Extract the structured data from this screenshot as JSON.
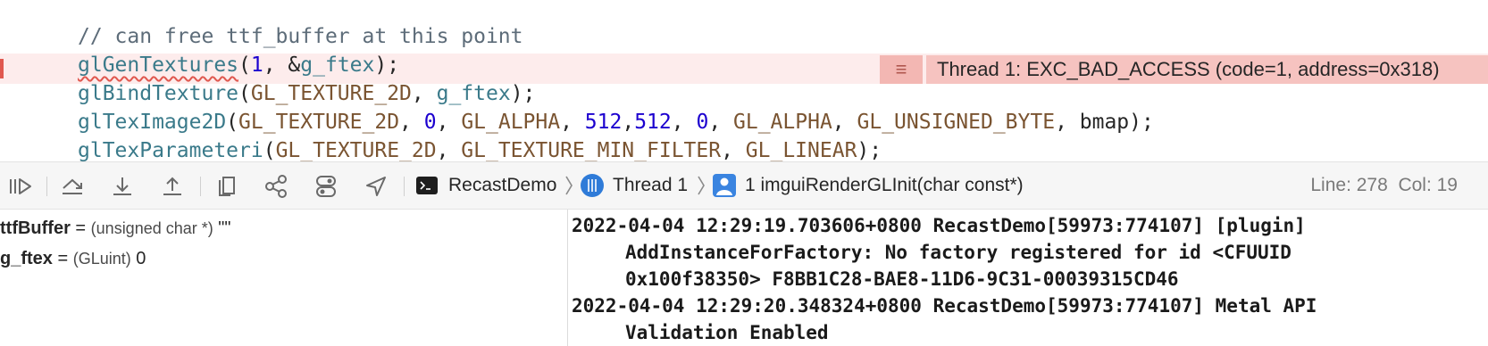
{
  "editor": {
    "comment_line": "// can free ttf_buffer at this point",
    "line_gen": {
      "fn": "glGenTextures",
      "open": "(",
      "num": "1",
      "mid": ", &",
      "arg": "g_ftex",
      "close": ");"
    },
    "line_bind": {
      "fn": "glBindTexture",
      "open": "(",
      "c1": "GL_TEXTURE_2D",
      "mid": ", ",
      "arg": "g_ftex",
      "close": ");"
    },
    "line_image": {
      "fn": "glTexImage2D",
      "open": "(",
      "c1": "GL_TEXTURE_2D",
      "s1": ", ",
      "n1": "0",
      "s2": ", ",
      "c2": "GL_ALPHA",
      "s3": ", ",
      "n2": "512",
      "s4": ",",
      "n3": "512",
      "s5": ", ",
      "n4": "0",
      "s6": ", ",
      "c3": "GL_ALPHA",
      "s7": ", ",
      "c4": "GL_UNSIGNED_BYTE",
      "s8": ", bmap);"
    },
    "line_param": {
      "fn": "glTexParameteri",
      "open": "(",
      "c1": "GL_TEXTURE_2D",
      "s1": ", ",
      "c2": "GL_TEXTURE_MIN_FILTER",
      "s2": ", ",
      "c3": "GL_LINEAR",
      "close": ");"
    },
    "error_annotation": "Thread 1: EXC_BAD_ACCESS (code=1, address=0x318)",
    "error_color": "#f6c3c0"
  },
  "debug_bar": {
    "buttons": [
      "continue-icon",
      "step-over-icon",
      "step-into-icon",
      "step-out-icon",
      "view-hierarchy-icon",
      "memory-graph-icon",
      "environment-overrides-icon",
      "simulate-location-icon"
    ],
    "target": "RecastDemo",
    "thread": "Thread 1",
    "frame": "1 imguiRenderGLInit(char const*)",
    "line": "Line: 278",
    "col": "Col: 19"
  },
  "variables": [
    {
      "name": "ttfBuffer",
      "eq": " = ",
      "type": "(unsigned char *)",
      "value": " \"\""
    },
    {
      "name": "g_ftex",
      "eq": " = ",
      "type": "(GLuint)",
      "value": " 0"
    }
  ],
  "console": {
    "entry1_line1": "2022-04-04 12:29:19.703606+0800 RecastDemo[59973:774107] [plugin]",
    "entry1_line2": "AddInstanceForFactory: No factory registered for id <CFUUID",
    "entry1_line3": "0x100f38350> F8BB1C28-BAE8-11D6-9C31-00039315CD46",
    "entry2_line1": "2022-04-04 12:29:20.348324+0800 RecastDemo[59973:774107] Metal API",
    "entry2_line2": "Validation Enabled"
  }
}
